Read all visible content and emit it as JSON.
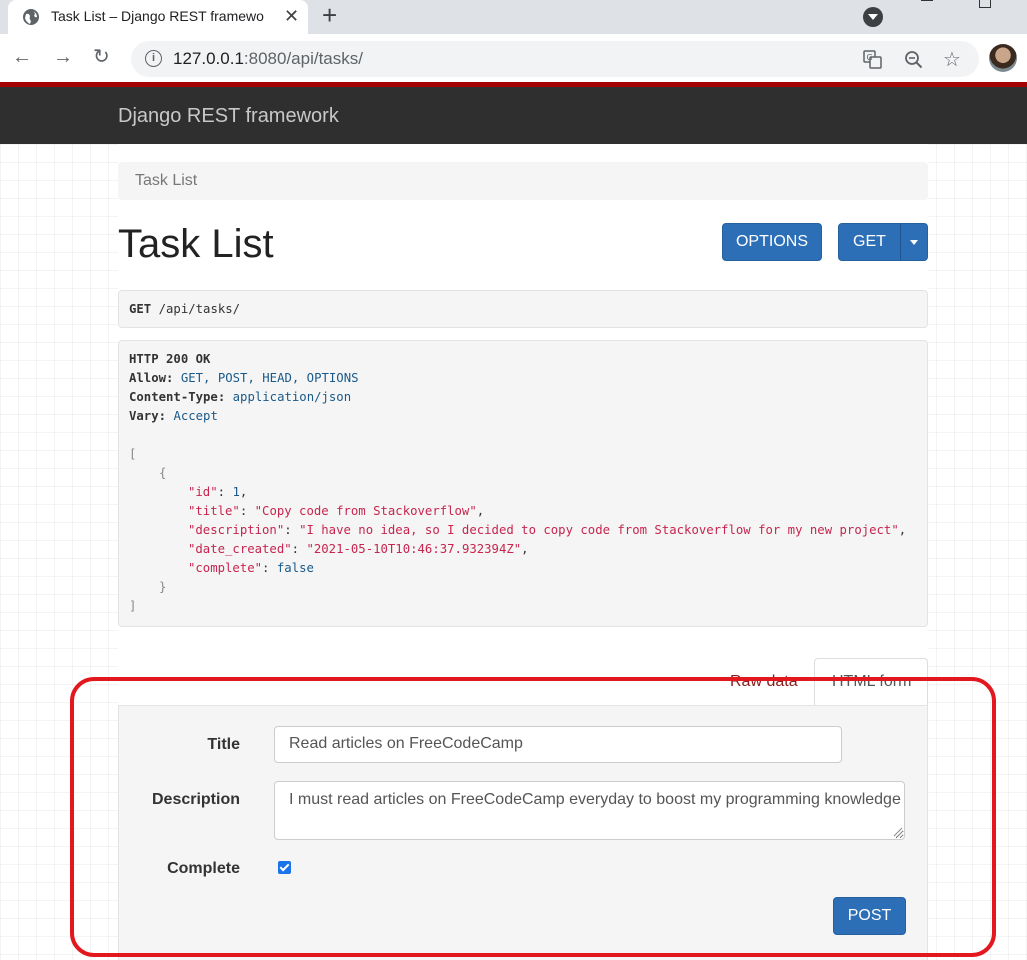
{
  "browser": {
    "tab_title": "Task List – Django REST framewo",
    "tab_close": "✕",
    "new_tab": "+",
    "url_host": "127.0.0.1",
    "url_rest": ":8080/api/tasks/",
    "nav": {
      "back": "←",
      "forward": "→",
      "reload": "↻"
    },
    "omni_icons": [
      "translate-icon",
      "zoom-icon",
      "star-icon"
    ]
  },
  "navbar": {
    "brand": "Django REST framework"
  },
  "breadcrumb": {
    "item": "Task List"
  },
  "page": {
    "title": "Task List",
    "options_label": "OPTIONS",
    "get_label": "GET"
  },
  "request": {
    "method": "GET",
    "path": "/api/tasks/"
  },
  "response": {
    "status": "HTTP 200 OK",
    "allow_key": "Allow:",
    "allow_val": "GET, POST, HEAD, OPTIONS",
    "ctype_key": "Content-Type:",
    "ctype_val": "application/json",
    "vary_key": "Vary:",
    "vary_val": "Accept",
    "open_bracket": "[",
    "open_brace": "{",
    "id_key": "\"id\"",
    "id_val": "1",
    "title_key": "\"title\"",
    "title_val": "\"Copy code from Stackoverflow\"",
    "desc_key": "\"description\"",
    "desc_val": "\"I have no idea, so I decided to copy code from Stackoverflow for my new project\"",
    "date_key": "\"date_created\"",
    "date_val": "\"2021-05-10T10:46:37.932394Z\"",
    "complete_key": "\"complete\"",
    "complete_val": "false",
    "close_brace": "}",
    "close_bracket": "]"
  },
  "form_tabs": {
    "raw": "Raw data",
    "html": "HTML form"
  },
  "form": {
    "title_label": "Title",
    "title_value": "Read articles on FreeCodeCamp",
    "description_label": "Description",
    "description_value": "I must read articles on FreeCodeCamp everyday to boost my programming knowledge",
    "complete_label": "Complete",
    "complete_checked": true,
    "post_label": "POST"
  },
  "colors": {
    "highlight_box": "#e3171e",
    "button": "#2c6fb7",
    "navbar": "#2f2f2f"
  }
}
